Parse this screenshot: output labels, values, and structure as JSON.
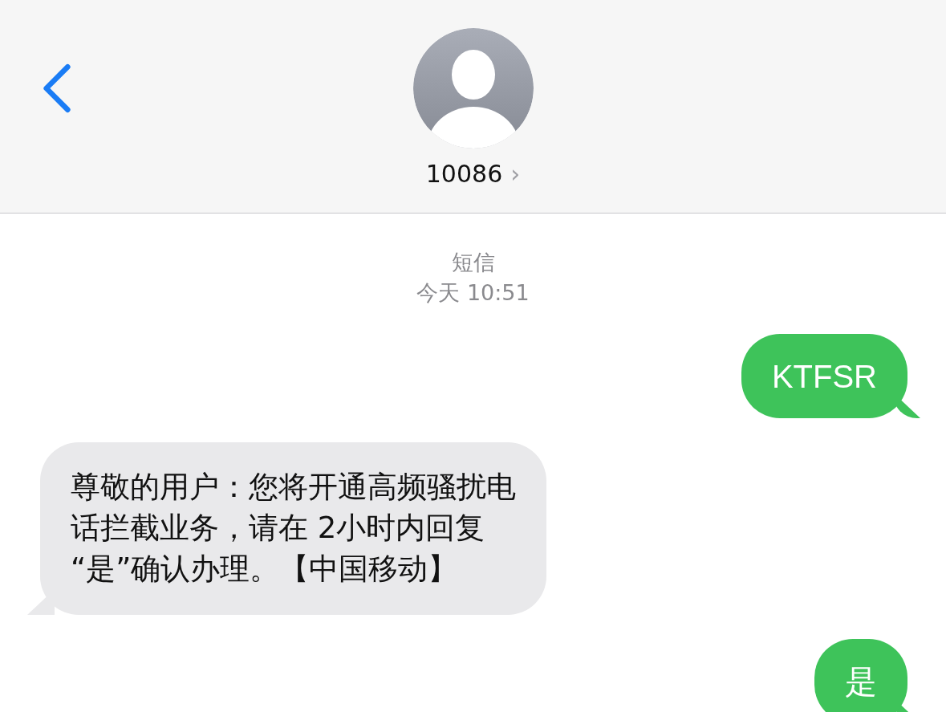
{
  "header": {
    "contact": "10086",
    "disclosure": "›"
  },
  "info": {
    "service": "短信",
    "timestamp": "今天 10:51"
  },
  "messages": [
    {
      "kind": "sent",
      "lines": [
        "KTFSR"
      ]
    },
    {
      "kind": "received",
      "lines": [
        "尊敬的用户：您将开通高频骚扰电",
        "话拦截业务，请在 2小时内回复",
        "“是”确认办理。【中国移动】"
      ]
    },
    {
      "kind": "sent",
      "lines": [
        "是"
      ]
    }
  ]
}
